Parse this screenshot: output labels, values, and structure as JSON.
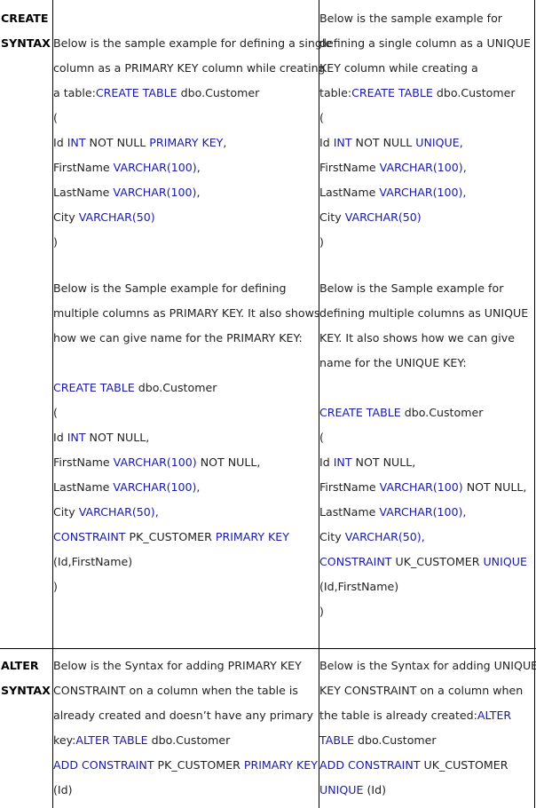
{
  "labels": {
    "create": [
      "CREATE",
      "SYNTAX"
    ],
    "alter": [
      "ALTER",
      "SYNTAX"
    ]
  },
  "create_primary": {
    "single": {
      "intro": [
        [
          {
            "t": "Below is the sample example for defining a single"
          }
        ],
        [
          {
            "t": "column as a PRIMARY KEY column while creating"
          }
        ],
        [
          {
            "t": "a table:"
          },
          {
            "t": "CREATE TABLE",
            "k": 1
          },
          {
            "t": " dbo.Customer"
          }
        ],
        [
          {
            "t": "("
          }
        ],
        [
          {
            "t": "Id "
          },
          {
            "t": "INT",
            "k": 1
          },
          {
            "t": " NOT NULL "
          },
          {
            "t": "PRIMARY KEY",
            "k": 1
          },
          {
            "t": ","
          }
        ],
        [
          {
            "t": "FirstName "
          },
          {
            "t": "VARCHAR(100)",
            "k": 1
          },
          {
            "t": ","
          }
        ],
        [
          {
            "t": "LastName "
          },
          {
            "t": "VARCHAR(100)",
            "k": 1
          },
          {
            "t": ","
          }
        ],
        [
          {
            "t": "City "
          },
          {
            "t": "VARCHAR(50)",
            "k": 1
          }
        ],
        [
          {
            "t": ")"
          }
        ]
      ]
    },
    "multi": [
      [
        {
          "t": "Below is the Sample example for defining"
        }
      ],
      [
        {
          "t": "multiple columns as PRIMARY KEY. It also shows"
        }
      ],
      [
        {
          "t": "how we can give name for the PRIMARY KEY:"
        }
      ],
      [],
      [
        {
          "t": "CREATE TABLE",
          "k": 1
        },
        {
          "t": " dbo.Customer"
        }
      ],
      [
        {
          "t": "("
        }
      ],
      [
        {
          "t": "Id "
        },
        {
          "t": "INT",
          "k": 1
        },
        {
          "t": " NOT NULL,"
        }
      ],
      [
        {
          "t": "FirstName "
        },
        {
          "t": "VARCHAR(100)",
          "k": 1
        },
        {
          "t": " NOT NULL,"
        }
      ],
      [
        {
          "t": "LastName "
        },
        {
          "t": "VARCHAR(100),",
          "k": 1
        }
      ],
      [
        {
          "t": "City "
        },
        {
          "t": "VARCHAR(50),",
          "k": 1
        }
      ],
      [
        {
          "t": "CONSTRAINT",
          "k": 1
        },
        {
          "t": " PK_CUSTOMER "
        },
        {
          "t": "PRIMARY KEY",
          "k": 1
        }
      ],
      [
        {
          "t": "(Id,FirstName)"
        }
      ],
      [
        {
          "t": ")"
        }
      ]
    ]
  },
  "create_unique": {
    "single": [
      [
        {
          "t": "Below is the sample example for"
        }
      ],
      [
        {
          "t": "defining a single column as a UNIQUE"
        }
      ],
      [
        {
          "t": "KEY column while creating a"
        }
      ],
      [
        {
          "t": "table:"
        },
        {
          "t": "CREATE TABLE",
          "k": 1
        },
        {
          "t": " dbo.Customer"
        }
      ],
      [
        {
          "t": "("
        }
      ],
      [
        {
          "t": "Id "
        },
        {
          "t": "INT",
          "k": 1
        },
        {
          "t": " NOT NULL "
        },
        {
          "t": "UNIQUE",
          "k": 1
        },
        {
          "t": ","
        }
      ],
      [
        {
          "t": "FirstName "
        },
        {
          "t": "VARCHAR(100),",
          "k": 1
        }
      ],
      [
        {
          "t": "LastName "
        },
        {
          "t": "VARCHAR(100),",
          "k": 1
        }
      ],
      [
        {
          "t": "City "
        },
        {
          "t": "VARCHAR(50)",
          "k": 1
        }
      ],
      [
        {
          "t": ")"
        }
      ]
    ],
    "multi": [
      [
        {
          "t": "Below is the Sample example for"
        }
      ],
      [
        {
          "t": "defining multiple columns as UNIQUE"
        }
      ],
      [
        {
          "t": "KEY. It also shows how we can give"
        }
      ],
      [
        {
          "t": "name for the UNIQUE KEY:"
        }
      ],
      [],
      [
        {
          "t": "CREATE TABLE",
          "k": 1
        },
        {
          "t": " dbo.Customer"
        }
      ],
      [
        {
          "t": "("
        }
      ],
      [
        {
          "t": "Id "
        },
        {
          "t": "INT",
          "k": 1
        },
        {
          "t": " NOT NULL,"
        }
      ],
      [
        {
          "t": "FirstName "
        },
        {
          "t": "VARCHAR(100)",
          "k": 1
        },
        {
          "t": " NOT NULL,"
        }
      ],
      [
        {
          "t": "LastName "
        },
        {
          "t": "VARCHAR(100),",
          "k": 1
        }
      ],
      [
        {
          "t": "City "
        },
        {
          "t": "VARCHAR(50),",
          "k": 1
        }
      ],
      [
        {
          "t": "CONSTRAINT",
          "k": 1
        },
        {
          "t": " UK_CUSTOMER "
        },
        {
          "t": "UNIQUE",
          "k": 1
        }
      ],
      [
        {
          "t": "(Id,FirstName)"
        }
      ],
      [
        {
          "t": ")"
        }
      ]
    ]
  },
  "alter_primary": [
    [
      {
        "t": "Below is the Syntax for adding PRIMARY KEY"
      }
    ],
    [
      {
        "t": "CONSTRAINT on a column when the table is"
      }
    ],
    [
      {
        "t": "already created and doesn’t have any primary"
      }
    ],
    [
      {
        "t": "key:"
      },
      {
        "t": "ALTER TABLE",
        "k": 1
      },
      {
        "t": " dbo.Customer"
      }
    ],
    [
      {
        "t": "ADD CONSTRAINT",
        "k": 1
      },
      {
        "t": " PK_CUSTOMER "
      },
      {
        "t": "PRIMARY KEY",
        "k": 1
      }
    ],
    [
      {
        "t": "(Id)"
      }
    ]
  ],
  "alter_unique": [
    [
      {
        "t": "Below is the Syntax for adding UNIQUE"
      }
    ],
    [
      {
        "t": "KEY CONSTRAINT on a column when"
      }
    ],
    [
      {
        "t": "the table is already created:"
      },
      {
        "t": "ALTER",
        "k": 1
      }
    ],
    [
      {
        "t": "TABLE",
        "k": 1
      },
      {
        "t": " dbo.Customer"
      }
    ],
    [
      {
        "t": "ADD CONSTRAINT",
        "k": 1
      },
      {
        "t": " UK_CUSTOMER"
      }
    ],
    [
      {
        "t": "UNIQUE",
        "k": 1
      },
      {
        "t": " (Id)"
      }
    ]
  ],
  "colors": {
    "keyword": "#1a1aa6",
    "text": "#222222",
    "border": "#000000"
  }
}
